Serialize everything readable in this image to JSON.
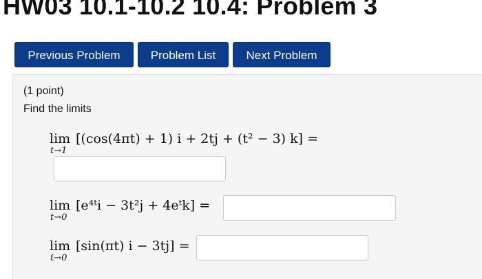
{
  "page_title": "HW03 10.1-10.2 10.4: Problem 3",
  "nav": {
    "previous": "Previous Problem",
    "list": "Problem List",
    "next": "Next Problem"
  },
  "problem": {
    "points": "(1 point)",
    "instruction": "Find the limits",
    "limits": [
      {
        "lim": "lim",
        "sub": "t→1",
        "expression": "[(cos(4πt) + 1) i + 2tj + (t² − 3) k] =",
        "answer": ""
      },
      {
        "lim": "lim",
        "sub": "t→0",
        "expression": "[e⁴ᵗi − 3t²j + 4eᵗk] =",
        "answer": ""
      },
      {
        "lim": "lim",
        "sub": "t→0",
        "expression": "[sin(πt) i − 3tj] =",
        "answer": ""
      }
    ]
  }
}
